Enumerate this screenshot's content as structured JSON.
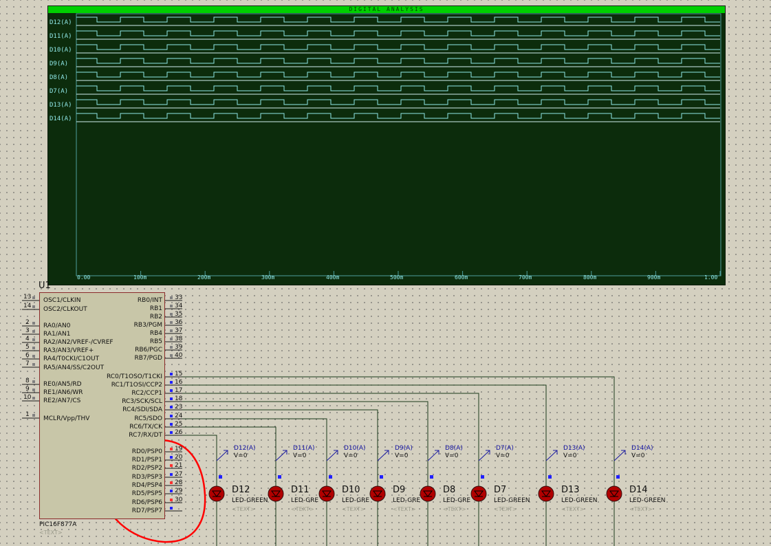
{
  "analysis": {
    "title": "DIGITAL ANALYSIS",
    "traces": [
      "D12(A)",
      "D11(A)",
      "D10(A)",
      "D9(A)",
      "D8(A)",
      "D7(A)",
      "D13(A)",
      "D14(A)"
    ],
    "x_ticks": [
      "0.00",
      "100m",
      "200m",
      "300m",
      "400m",
      "500m",
      "600m",
      "700m",
      "800m",
      "900m",
      "1.00"
    ],
    "trace_color": "#8fe7e7",
    "background_color": "#0c2c0c",
    "title_bar_color": "#00d000"
  },
  "chip": {
    "ref": "U1",
    "part": "PIC16F877A",
    "text": "<TEXT>",
    "left_pins": [
      {
        "num": "13",
        "name": "OSC1/CLKIN"
      },
      {
        "num": "14",
        "name": "OSC2/CLKOUT"
      },
      {
        "num": "2",
        "name": "RA0/AN0"
      },
      {
        "num": "3",
        "name": "RA1/AN1"
      },
      {
        "num": "4",
        "name": "RA2/AN2/VREF-/CVREF"
      },
      {
        "num": "5",
        "name": "RA3/AN3/VREF+"
      },
      {
        "num": "6",
        "name": "RA4/T0CKI/C1OUT"
      },
      {
        "num": "7",
        "name": "RA5/AN4/SS/C2OUT"
      },
      {
        "num": "8",
        "name": "RE0/AN5/RD"
      },
      {
        "num": "9",
        "name": "RE1/AN6/WR"
      },
      {
        "num": "10",
        "name": "RE2/AN7/CS"
      },
      {
        "num": "1",
        "name": "MCLR/Vpp/THV"
      }
    ],
    "right_pins": [
      {
        "num": "33",
        "name": "RB0/INT"
      },
      {
        "num": "34",
        "name": "RB1"
      },
      {
        "num": "35",
        "name": "RB2"
      },
      {
        "num": "36",
        "name": "RB3/PGM"
      },
      {
        "num": "37",
        "name": "RB4"
      },
      {
        "num": "38",
        "name": "RB5"
      },
      {
        "num": "39",
        "name": "RB6/PGC"
      },
      {
        "num": "40",
        "name": "RB7/PGD"
      },
      {
        "num": "15",
        "name": "RC0/T1OSO/T1CKI"
      },
      {
        "num": "16",
        "name": "RC1/T1OSI/CCP2"
      },
      {
        "num": "17",
        "name": "RC2/CCP1"
      },
      {
        "num": "18",
        "name": "RC3/SCK/SCL"
      },
      {
        "num": "23",
        "name": "RC4/SDI/SDA"
      },
      {
        "num": "24",
        "name": "RC5/SDO"
      },
      {
        "num": "25",
        "name": "RC6/TX/CK"
      },
      {
        "num": "26",
        "name": "RC7/RX/DT"
      },
      {
        "num": "19",
        "name": "RD0/PSP0"
      },
      {
        "num": "20",
        "name": "RD1/PSP1"
      },
      {
        "num": "21",
        "name": "RD2/PSP2"
      },
      {
        "num": "27",
        "name": "RD3/PSP3"
      },
      {
        "num": "28",
        "name": "RD4/PSP4"
      },
      {
        "num": "29",
        "name": "RD5/PSP5"
      },
      {
        "num": "30",
        "name": "RD6/PSP6"
      },
      {
        "num": "",
        "name": "RD7/PSP7"
      }
    ]
  },
  "leds": [
    {
      "ref": "D12",
      "value": "LED-GREEN",
      "text": "<TEXT>",
      "probe": "D12(A)",
      "probe_value": "V=0"
    },
    {
      "ref": "D11",
      "value": "LED-GRE",
      "text": "<TEXT>",
      "probe": "D11(A)",
      "probe_value": "V=0"
    },
    {
      "ref": "D10",
      "value": "LED-GRE",
      "text": "<TEXT>",
      "probe": "D10(A)",
      "probe_value": "V=0"
    },
    {
      "ref": "D9",
      "value": "LED-GRE",
      "text": "<TEXT>",
      "probe": "D9(A)",
      "probe_value": "V=0"
    },
    {
      "ref": "D8",
      "value": "LED-GRE",
      "text": "<TEXT>",
      "probe": "D8(A)",
      "probe_value": "V=0"
    },
    {
      "ref": "D7",
      "value": "LED-GREEN",
      "text": "<TEXT>",
      "probe": "D7(A)",
      "probe_value": "V=0"
    },
    {
      "ref": "D13",
      "value": "LED-GREEN",
      "text": "<TEXT>",
      "probe": "D13(A)",
      "probe_value": "V=0"
    },
    {
      "ref": "D14",
      "value": "LED-GREEN",
      "text": "<TEXT>",
      "probe": "D14(A)",
      "probe_value": "V=0"
    }
  ],
  "colors": {
    "wire": "#1a3a1a",
    "led_body": "#b00000",
    "annotation": "#ff0000",
    "pin_marker": "#2020ff"
  }
}
